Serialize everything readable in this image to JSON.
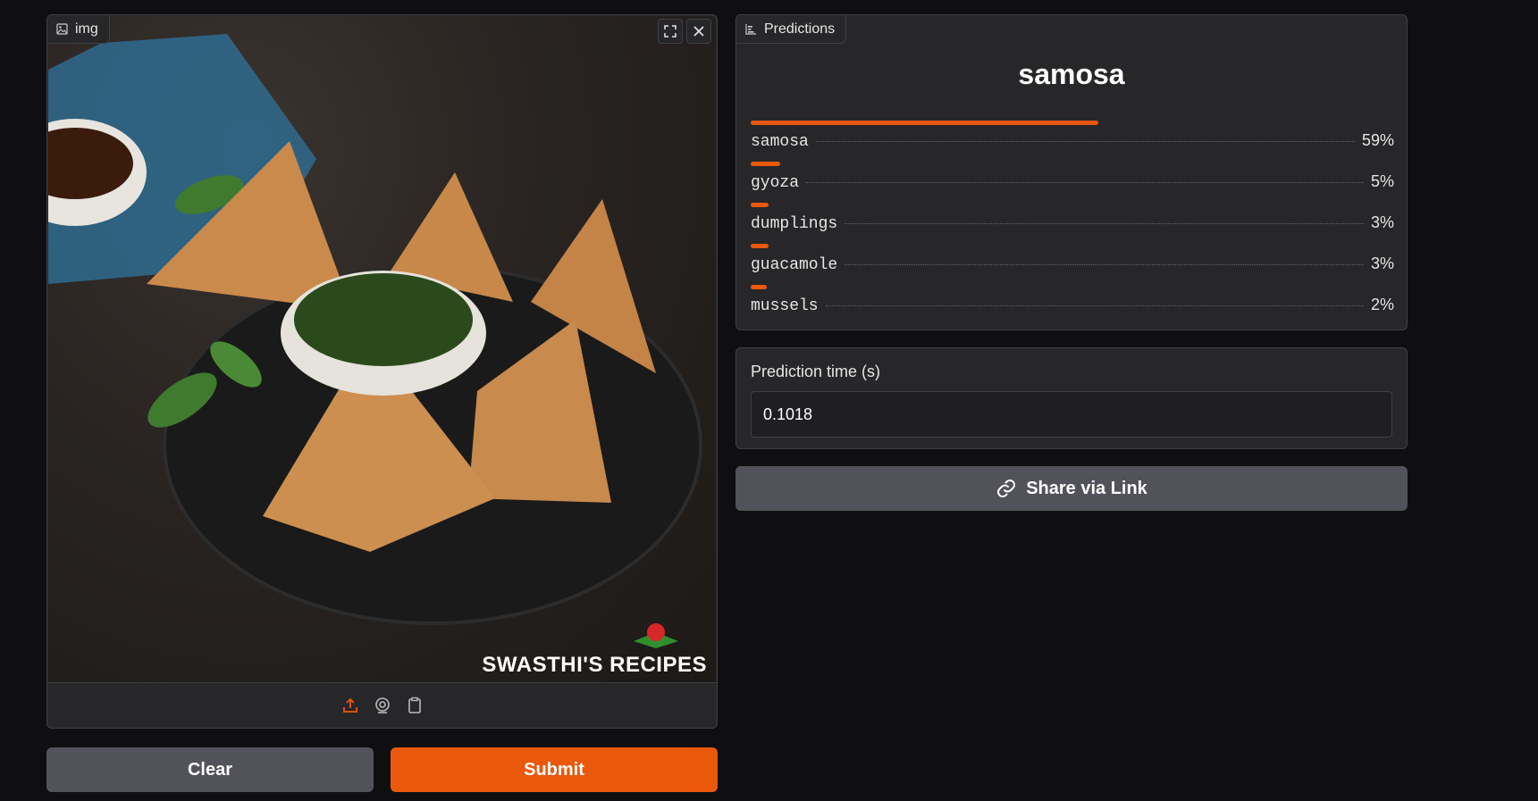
{
  "image_input": {
    "tab_label": "img",
    "watermark": "SWASTHI'S RECIPES",
    "icons": [
      "image-icon",
      "fullscreen-icon",
      "close-icon",
      "upload-icon",
      "webcam-icon",
      "clipboard-icon"
    ]
  },
  "buttons": {
    "clear": "Clear",
    "submit": "Submit",
    "share": "Share via Link"
  },
  "predictions": {
    "tab_label": "Predictions",
    "top_label": "samosa",
    "items": [
      {
        "label": "samosa",
        "pct": "59%",
        "value": 0.59
      },
      {
        "label": "gyoza",
        "pct": "5%",
        "value": 0.05
      },
      {
        "label": "dumplings",
        "pct": "3%",
        "value": 0.03
      },
      {
        "label": "guacamole",
        "pct": "3%",
        "value": 0.03
      },
      {
        "label": "mussels",
        "pct": "2%",
        "value": 0.02
      }
    ]
  },
  "prediction_time": {
    "label": "Prediction time (s)",
    "value": "0.1018"
  },
  "colors": {
    "accent": "#ea580c",
    "panel": "#27272a",
    "background": "#0f0f11",
    "secondary_button": "#52525b"
  }
}
